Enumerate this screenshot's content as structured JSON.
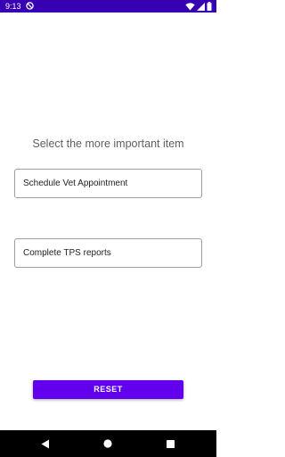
{
  "status_bar": {
    "time": "9:13",
    "icons": [
      "dnd-icon",
      "wifi-icon",
      "signal-icon",
      "battery-icon"
    ]
  },
  "main": {
    "prompt": "Select the more important item",
    "items": [
      {
        "label": "Schedule Vet Appointment"
      },
      {
        "label": "Complete TPS reports"
      }
    ],
    "reset_label": "RESET"
  },
  "nav_bar": {
    "icons": [
      "back-icon",
      "home-icon",
      "recents-icon"
    ]
  },
  "colors": {
    "status_bar": "#3700b3",
    "accent": "#6200ee",
    "nav_bar": "#000000"
  }
}
